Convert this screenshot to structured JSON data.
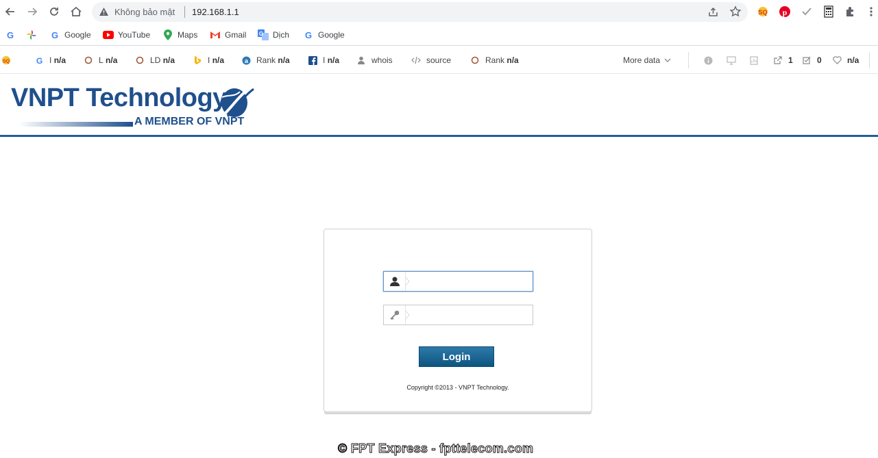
{
  "browser": {
    "security_label": "Không bảo mật",
    "url": "192.168.1.1"
  },
  "bookmarks": [
    {
      "icon": "google-icon",
      "label": ""
    },
    {
      "icon": "pinwheel-icon",
      "label": ""
    },
    {
      "icon": "google-icon",
      "label": "Google"
    },
    {
      "icon": "youtube-icon",
      "label": "YouTube"
    },
    {
      "icon": "maps-icon",
      "label": "Maps"
    },
    {
      "icon": "gmail-icon",
      "label": "Gmail"
    },
    {
      "icon": "translate-icon",
      "label": "Dịch"
    },
    {
      "icon": "google-icon",
      "label": "Google"
    }
  ],
  "seo_toolbar": {
    "items": [
      {
        "icon": "google-icon",
        "prefix": "I",
        "value": "n/a"
      },
      {
        "icon": "circle-icon",
        "prefix": "L",
        "value": "n/a"
      },
      {
        "icon": "circle-icon",
        "prefix": "LD",
        "value": "n/a"
      },
      {
        "icon": "bing-icon",
        "prefix": "I",
        "value": "n/a"
      },
      {
        "icon": "alexa-icon",
        "prefix": "Rank",
        "value": "n/a"
      },
      {
        "icon": "facebook-icon",
        "prefix": "I",
        "value": "n/a"
      },
      {
        "icon": "user-icon",
        "prefix": "whois",
        "value": ""
      },
      {
        "icon": "code-icon",
        "prefix": "source",
        "value": ""
      },
      {
        "icon": "circle-icon",
        "prefix": "Rank",
        "value": "n/a"
      }
    ],
    "more_data": "More data",
    "external_links": "1",
    "checked_count": "0",
    "heart_value": "n/a"
  },
  "page": {
    "logo_text": "VNPT Technology",
    "logo_tagline": "A MEMBER OF VNPT",
    "username_value": "",
    "password_value": "",
    "login_label": "Login",
    "copyright": "Copyright ©2013 - VNPT Technology."
  },
  "watermark": "© FPT Express - fpttelecom.com",
  "colors": {
    "brand_blue": "#1f4f8d",
    "header_rule": "#1f5f97",
    "login_button": "#0e5581"
  }
}
